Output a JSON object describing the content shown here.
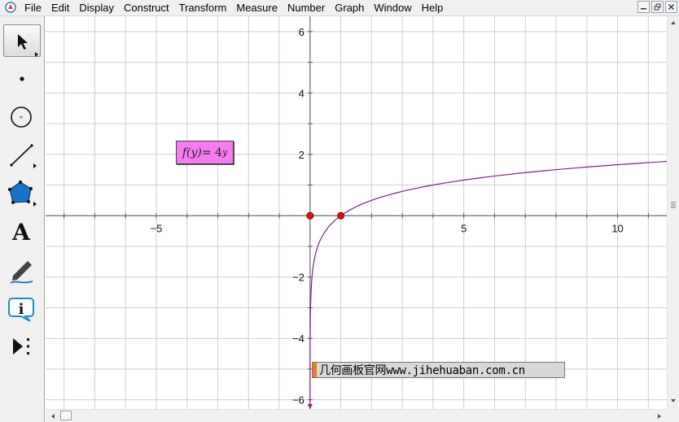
{
  "menu": {
    "items": [
      "File",
      "Edit",
      "Display",
      "Construct",
      "Transform",
      "Measure",
      "Number",
      "Graph",
      "Window",
      "Help"
    ]
  },
  "toolbox": {
    "tools": [
      {
        "name": "selection-arrow-tool",
        "icon": "arrow-cursor-icon",
        "active": true
      },
      {
        "name": "point-tool",
        "icon": "point-icon"
      },
      {
        "name": "compass-tool",
        "icon": "circle-icon"
      },
      {
        "name": "straightedge-tool",
        "icon": "segment-icon"
      },
      {
        "name": "polygon-tool",
        "icon": "pentagon-icon"
      },
      {
        "name": "text-tool",
        "icon": "text-a-icon",
        "glyph": "A"
      },
      {
        "name": "marker-tool",
        "icon": "pen-icon"
      },
      {
        "name": "information-tool",
        "icon": "info-icon",
        "glyph": "i"
      },
      {
        "name": "custom-tool",
        "icon": "custom-tools-icon"
      }
    ]
  },
  "graph": {
    "x_range": [
      -8.6,
      11.6
    ],
    "y_range": [
      -6.3,
      6.5
    ],
    "x_ticks": [
      -5,
      5,
      10
    ],
    "y_ticks": [
      6,
      4,
      2,
      -2,
      -4,
      -6
    ],
    "curve": {
      "function": "log base 4 of x",
      "color": "#8a1a8a"
    },
    "points": [
      {
        "x": 0,
        "y": 0,
        "color": "#dd1111"
      },
      {
        "x": 1,
        "y": 0,
        "color": "#dd1111"
      }
    ],
    "grid": true
  },
  "function_label": {
    "f": "f",
    "var": "y",
    "equals": " = 4",
    "exponent": "y",
    "background": "#f47cf0"
  },
  "watermark": {
    "text": "几何画板官网www.jihehuaban.com.cn",
    "accent": "#f07a1a"
  }
}
